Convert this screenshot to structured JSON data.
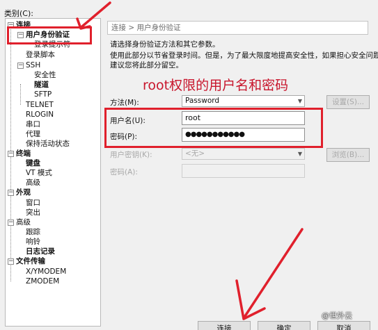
{
  "category_label": "类别(C):",
  "tree": {
    "items": [
      {
        "label": "连接",
        "bold": true,
        "toggle": "−"
      },
      {
        "label": "用户身份验证",
        "bold": true,
        "toggle": "−"
      },
      {
        "label": "登录提示符",
        "bold": false,
        "toggle": ""
      },
      {
        "label": "登录脚本",
        "bold": false,
        "toggle": ""
      },
      {
        "label": "SSH",
        "bold": false,
        "toggle": "−"
      },
      {
        "label": "安全性",
        "bold": false,
        "toggle": ""
      },
      {
        "label": "隧道",
        "bold": true,
        "toggle": ""
      },
      {
        "label": "SFTP",
        "bold": false,
        "toggle": ""
      },
      {
        "label": "TELNET",
        "bold": false,
        "toggle": ""
      },
      {
        "label": "RLOGIN",
        "bold": false,
        "toggle": ""
      },
      {
        "label": "串口",
        "bold": false,
        "toggle": ""
      },
      {
        "label": "代理",
        "bold": false,
        "toggle": ""
      },
      {
        "label": "保持活动状态",
        "bold": false,
        "toggle": ""
      },
      {
        "label": "终端",
        "bold": true,
        "toggle": "−"
      },
      {
        "label": "键盘",
        "bold": true,
        "toggle": ""
      },
      {
        "label": "VT 模式",
        "bold": false,
        "toggle": ""
      },
      {
        "label": "高级",
        "bold": false,
        "toggle": ""
      },
      {
        "label": "外观",
        "bold": true,
        "toggle": "−"
      },
      {
        "label": "窗口",
        "bold": false,
        "toggle": ""
      },
      {
        "label": "突出",
        "bold": false,
        "toggle": ""
      },
      {
        "label": "高级",
        "bold": false,
        "toggle": "−"
      },
      {
        "label": "跟踪",
        "bold": false,
        "toggle": ""
      },
      {
        "label": "响铃",
        "bold": false,
        "toggle": ""
      },
      {
        "label": "日志记录",
        "bold": true,
        "toggle": ""
      },
      {
        "label": "文件传输",
        "bold": true,
        "toggle": "−"
      },
      {
        "label": "X/YMODEM",
        "bold": false,
        "toggle": ""
      },
      {
        "label": "ZMODEM",
        "bold": false,
        "toggle": ""
      }
    ]
  },
  "breadcrumb": "连接 > 用户身份验证",
  "description": {
    "line1": "请选择身份验证方法和其它参数。",
    "line2": "使用此部分以节省登录时间。但是，为了最大限度地提高安全性，如果担心安全问题，",
    "line3": "建议您将此部分留空。"
  },
  "annotation_title": "root权限的用户名和密码",
  "form": {
    "method_label": "方法(M):",
    "method_value": "Password",
    "settings_button": "设置(S)...",
    "username_label": "用户名(U):",
    "username_value": "root",
    "password_label": "密码(P):",
    "password_value": "●●●●●●●●●●●",
    "user_key_label": "用户密钥(K):",
    "user_key_value": "<无>",
    "browse_button": "浏览(B)...",
    "passphrase_label": "密码(A):"
  },
  "buttons": {
    "connect": "连接",
    "ok": "确定",
    "cancel": "取消"
  },
  "watermark": "@世外云",
  "colors": {
    "annotation_red": "#e0202c",
    "annotation_text": "#c8152c"
  }
}
